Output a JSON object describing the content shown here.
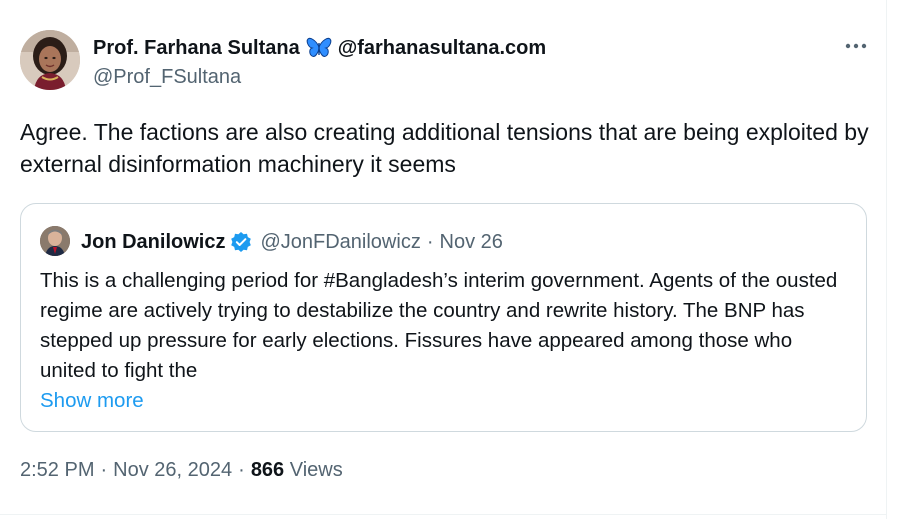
{
  "tweet": {
    "author": {
      "display_name": "Prof. Farhana Sultana",
      "bio_handle": "@farhanasultana.com",
      "handle": "@Prof_FSultana",
      "avatar_icon": "profile-photo-icon"
    },
    "text": "Agree. The factions are also creating additional tensions that are being exploited by external disinformation machinery it seems",
    "more_icon": "ellipsis-icon",
    "time": "2:52 PM",
    "date": "Nov 26, 2024",
    "separator": "·",
    "views_count": "866",
    "views_label": "Views"
  },
  "quote": {
    "author": {
      "display_name": "Jon Danilowicz",
      "handle": "@JonFDanilowicz",
      "verified_icon": "verified-badge-icon",
      "avatar_icon": "profile-photo-icon"
    },
    "separator": "·",
    "date": "Nov 26",
    "text": "This is a challenging period for #Bangladesh’s interim government.   Agents of the ousted regime are actively trying to destabilize the country and rewrite history.  The BNP has stepped up pressure for early elections.   Fissures have appeared among those who united to fight the",
    "show_more_label": "Show more"
  },
  "colors": {
    "text_primary": "#0f1419",
    "text_secondary": "#536471",
    "link": "#1d9bf0",
    "border": "#cfd9de",
    "butterfly_blue": "#0a7aff",
    "verified_blue": "#1d9bf0"
  }
}
